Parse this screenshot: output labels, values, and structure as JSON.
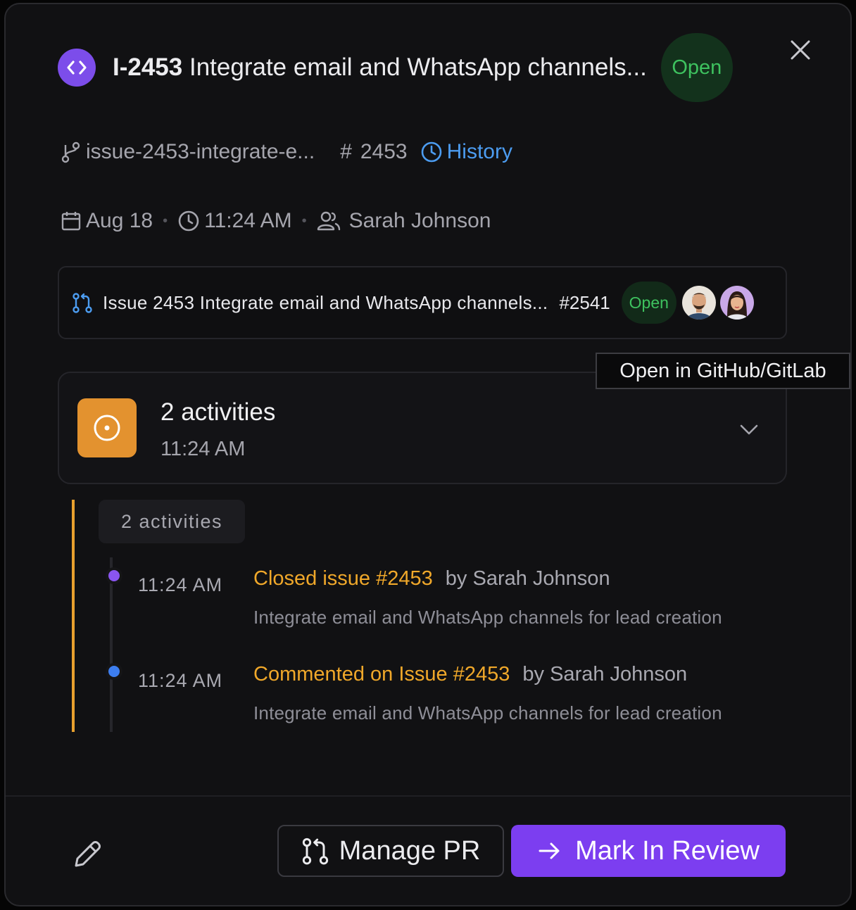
{
  "header": {
    "issue_key": "I-2453",
    "title": "Integrate email and WhatsApp channels...",
    "status": "Open",
    "status_color": "#3ec25f",
    "close_icon": "close-icon"
  },
  "meta": {
    "branch": "issue-2453-integrate-e...",
    "issue_number": "2453",
    "history_label": "History",
    "date": "Aug 18",
    "time": "11:24 AM",
    "assignee": "Sarah Johnson"
  },
  "pull_request": {
    "title": "Issue 2453 Integrate email and WhatsApp channels...",
    "number": "#2541",
    "status": "Open",
    "tooltip": "Open in GitHub/GitLab"
  },
  "activity_summary": {
    "title": "2 activities",
    "time": "11:24 AM",
    "accent_color": "#e3922f"
  },
  "timeline": {
    "group_label": "2 activities",
    "events": [
      {
        "time": "11:24 AM",
        "action": "Closed issue #2453",
        "by": "by Sarah Johnson",
        "description": "Integrate email and WhatsApp channels for lead creation"
      },
      {
        "time": "11:24 AM",
        "action": "Commented on Issue #2453",
        "by": "by Sarah Johnson",
        "description": "Integrate email and WhatsApp channels for lead creation"
      }
    ]
  },
  "footer": {
    "manage_pr_label": "Manage PR",
    "mark_review_label": "Mark In Review",
    "primary_color": "#7c3ef0"
  }
}
